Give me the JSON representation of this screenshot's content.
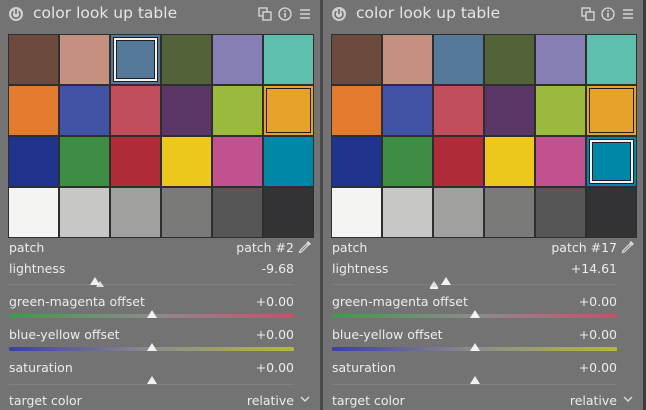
{
  "panels": [
    {
      "title": "color look up table",
      "patches": [
        "#6d4a3e",
        "#c49180",
        "#567899",
        "#546239",
        "#857fb4",
        "#5ebfae",
        "#e27b2e",
        "#4253a6",
        "#c14e5b",
        "#5b3767",
        "#9cb93f",
        "#e6a22a",
        "#20348e",
        "#3f8d45",
        "#ad2c38",
        "#edc81c",
        "#c2518f",
        "#0086a6",
        "#f4f4f2",
        "#c7c8c6",
        "#a0a19f",
        "#7a7b79",
        "#555655",
        "#333335"
      ],
      "selected_index": 2,
      "highlighted_index": 11,
      "patch_label": "patch",
      "patch_value": "patch #2",
      "lightness_label": "lightness",
      "lightness_value": "-9.68",
      "lightness_level": 0.3,
      "green_magenta_label": "green-magenta offset",
      "green_magenta_value": "+0.00",
      "green_magenta_level": 0.5,
      "blue_yellow_label": "blue-yellow offset",
      "blue_yellow_value": "+0.00",
      "blue_yellow_level": 0.5,
      "saturation_label": "saturation",
      "saturation_value": "+0.00",
      "saturation_level": 0.5,
      "target_color_label": "target color",
      "target_color_value": "relative"
    },
    {
      "title": "color look up table",
      "patches": [
        "#6d4a3e",
        "#c49180",
        "#567899",
        "#546239",
        "#857fb4",
        "#5ebfae",
        "#e27b2e",
        "#4253a6",
        "#c14e5b",
        "#5b3767",
        "#9cb93f",
        "#e6a22a",
        "#20348e",
        "#3f8d45",
        "#ad2c38",
        "#edc81c",
        "#c2518f",
        "#0086a6",
        "#f4f4f2",
        "#c7c8c6",
        "#a0a19f",
        "#7a7b79",
        "#555655",
        "#333335"
      ],
      "selected_index": 17,
      "highlighted_index": 11,
      "patch_label": "patch",
      "patch_value": "patch #17",
      "lightness_label": "lightness",
      "lightness_value": "+14.61",
      "lightness_level": 0.4,
      "green_magenta_label": "green-magenta offset",
      "green_magenta_value": "+0.00",
      "green_magenta_level": 0.5,
      "blue_yellow_label": "blue-yellow offset",
      "blue_yellow_value": "+0.00",
      "blue_yellow_level": 0.5,
      "saturation_label": "saturation",
      "saturation_value": "+0.00",
      "saturation_level": 0.5,
      "target_color_label": "target color",
      "target_color_value": "relative"
    }
  ],
  "icons": {
    "power": "power-icon",
    "presets": "presets-icon",
    "info": "info-icon",
    "menu": "menu-icon",
    "picker": "color-picker-icon",
    "dropdown": "chevron-down-icon"
  }
}
